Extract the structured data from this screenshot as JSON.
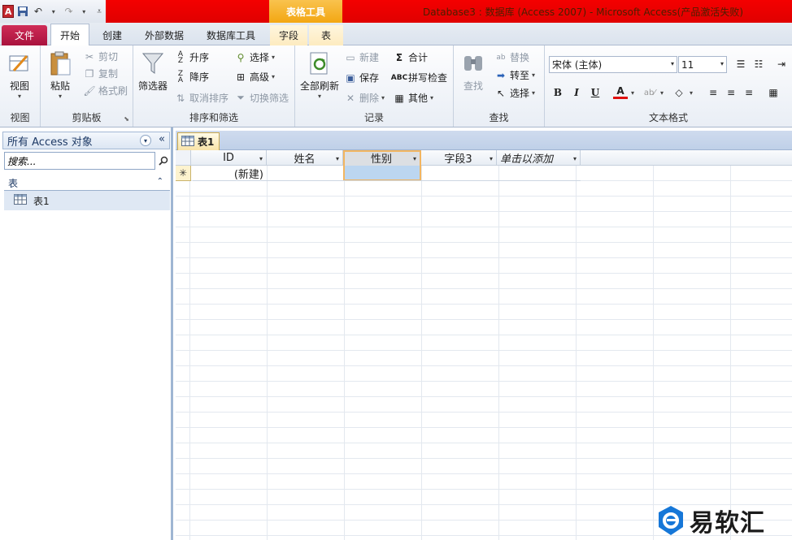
{
  "titlebar": {
    "context_tools": "表格工具",
    "title": "Database3 : 数据库 (Access 2007) - Microsoft Access(产品激活失败)",
    "app_icon": "A"
  },
  "tabs": [
    {
      "label": "文件"
    },
    {
      "label": "开始"
    },
    {
      "label": "创建"
    },
    {
      "label": "外部数据"
    },
    {
      "label": "数据库工具"
    },
    {
      "label": "字段"
    },
    {
      "label": "表"
    }
  ],
  "ribbon": {
    "view": {
      "button": "视图",
      "group": "视图"
    },
    "clipboard": {
      "paste": "粘贴",
      "cut": "剪切",
      "copy": "复制",
      "format_painter": "格式刷",
      "group": "剪贴板"
    },
    "sort_filter": {
      "filter": "筛选器",
      "ascending": "升序",
      "descending": "降序",
      "remove_sort": "取消排序",
      "selection": "选择",
      "advanced": "高级",
      "toggle_filter": "切换筛选",
      "group": "排序和筛选"
    },
    "records": {
      "refresh_all": "全部刷新",
      "new": "新建",
      "save": "保存",
      "delete": "删除",
      "totals": "合计",
      "spelling": "拼写检查",
      "more": "其他",
      "group": "记录"
    },
    "find": {
      "find": "查找",
      "replace": "替换",
      "goto": "转至",
      "select": "选择",
      "group": "查找"
    },
    "text_format": {
      "font": "宋体 (主体)",
      "size": "11",
      "bold": "B",
      "italic": "I",
      "underline": "U",
      "group": "文本格式"
    }
  },
  "nav": {
    "header": "所有 Access 对象",
    "search_placeholder": "搜索...",
    "group": "表",
    "items": [
      {
        "label": "表1"
      }
    ]
  },
  "document": {
    "tab": "表1",
    "columns": [
      {
        "label": "ID"
      },
      {
        "label": "姓名"
      },
      {
        "label": "性别"
      },
      {
        "label": "字段3"
      },
      {
        "label": "单击以添加"
      }
    ],
    "new_row_marker": "✳",
    "new_row_id": "(新建)"
  },
  "watermark": {
    "text": "易软汇"
  },
  "colors": {
    "title_red": "#e00000",
    "context_orange": "#f3a712",
    "file_tab": "#b8174a",
    "selected_cell": "#bcd6f0"
  }
}
